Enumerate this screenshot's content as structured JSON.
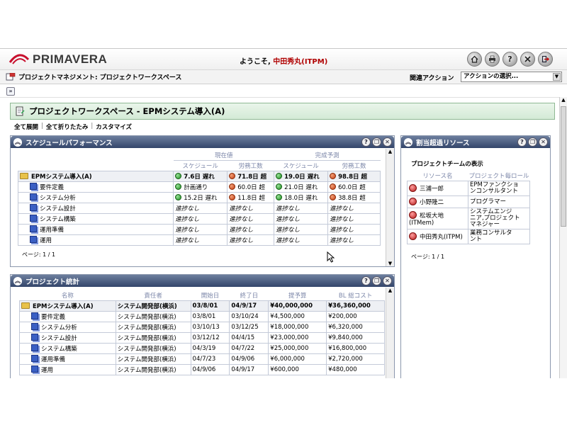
{
  "header": {
    "logo_text": "PRIMAVERA",
    "welcome_prefix": "ようこそ,",
    "user_name": "中田秀丸(ITPM)"
  },
  "breadcrumb": "プロジェクトマネジメント: プロジェクトワークスペース",
  "related_actions_label": "関連アクション",
  "action_select_value": "アクションの選択...",
  "workspace_title": "プロジェクトワークスペース - EPMシステム導入(A)",
  "links": {
    "expand_all": "全て展開",
    "collapse_all": "全て折りたたみ",
    "customize": "カスタマイズ"
  },
  "schedule": {
    "title": "スケジュールパフォーマンス",
    "group_current": "現在値",
    "group_forecast": "完成予測",
    "col_schedule": "スケジュール",
    "col_labor": "労務工数",
    "col_schedule2": "スケジュール",
    "col_labor2": "労務工数",
    "rows": [
      {
        "name": "EPMシステム導入(A)",
        "kind": "group",
        "s1": "7.6日 遅れ",
        "s1c": "g",
        "l1": "71.8日 超",
        "l1c": "r",
        "s2": "19.0日 遅れ",
        "s2c": "g",
        "l2": "98.8日 超",
        "l2c": "r"
      },
      {
        "name": "要件定義",
        "kind": "task",
        "s1": "計画通り",
        "s1c": "g",
        "l1": "60.0日 超",
        "l1c": "r",
        "s2": "21.0日 遅れ",
        "s2c": "g",
        "l2": "60.0日 超",
        "l2c": "r"
      },
      {
        "name": "システム分析",
        "kind": "task",
        "s1": "15.2日 遅れ",
        "s1c": "g",
        "l1": "11.8日 超",
        "l1c": "r",
        "s2": "18.0日 遅れ",
        "s2c": "g",
        "l2": "38.8日 超",
        "l2c": "r"
      },
      {
        "name": "システム設計",
        "kind": "task",
        "s1": "進捗なし",
        "l1": "進捗なし",
        "s2": "進捗なし",
        "l2": "進捗なし"
      },
      {
        "name": "システム構築",
        "kind": "task",
        "s1": "進捗なし",
        "l1": "進捗なし",
        "s2": "進捗なし",
        "l2": "進捗なし"
      },
      {
        "name": "運用準備",
        "kind": "task",
        "s1": "進捗なし",
        "l1": "進捗なし",
        "s2": "進捗なし",
        "l2": "進捗なし"
      },
      {
        "name": "運用",
        "kind": "task",
        "s1": "進捗なし",
        "l1": "進捗なし",
        "s2": "進捗なし",
        "l2": "進捗なし"
      }
    ],
    "page_info": "ページ: 1 / 1"
  },
  "resources": {
    "title": "割当超過リソース",
    "subtitle": "プロジェクトチームの表示",
    "col_resource": "リソース名",
    "col_role": "プロジェクト毎ロール",
    "rows": [
      {
        "name": "三浦一郎",
        "role": "EPMファンクショ\nンコンサルタント"
      },
      {
        "name": "小野隆二",
        "role": "プログラマー"
      },
      {
        "name": "松坂大地\n(ITMem)",
        "role": "システムエンジ\nニア,プロジェクト\nマネジャー"
      },
      {
        "name": "中田秀丸(ITPM)",
        "role": "業務コンサルタ\nント"
      }
    ],
    "page_info": "ページ: 1 / 1"
  },
  "stats": {
    "title": "プロジェクト統計",
    "cols": [
      "名称",
      "責任者",
      "開始日",
      "終了日",
      "提予算",
      "BL 総コスト"
    ],
    "rows": [
      {
        "name": "EPMシステム導入(A)",
        "kind": "group",
        "owner": "システム開発部(横浜)",
        "start": "03/8/01",
        "end": "04/9/17",
        "budget": "¥40,000,000",
        "cost": "¥36,360,000"
      },
      {
        "name": "要件定義",
        "kind": "task",
        "owner": "システム開発部(横浜)",
        "start": "03/8/01",
        "end": "03/10/24",
        "budget": "¥4,500,000",
        "cost": "¥200,000"
      },
      {
        "name": "システム分析",
        "kind": "task",
        "owner": "システム開発部(横浜)",
        "start": "03/10/13",
        "end": "03/12/25",
        "budget": "¥18,000,000",
        "cost": "¥6,320,000"
      },
      {
        "name": "システム設計",
        "kind": "task",
        "owner": "システム開発部(横浜)",
        "start": "03/12/12",
        "end": "04/4/15",
        "budget": "¥23,000,000",
        "cost": "¥9,840,000"
      },
      {
        "name": "システム構築",
        "kind": "task",
        "owner": "システム開発部(横浜)",
        "start": "04/3/19",
        "end": "04/7/22",
        "budget": "¥25,000,000",
        "cost": "¥16,800,000"
      },
      {
        "name": "運用準備",
        "kind": "task",
        "owner": "システム開発部(横浜)",
        "start": "04/7/23",
        "end": "04/9/06",
        "budget": "¥6,000,000",
        "cost": "¥2,720,000"
      },
      {
        "name": "運用",
        "kind": "task",
        "owner": "システム開発部(横浜)",
        "start": "04/9/06",
        "end": "04/9/17",
        "budget": "¥600,000",
        "cost": "¥480,000"
      }
    ]
  },
  "icons": {
    "header": [
      "home-icon",
      "print-icon",
      "help-icon",
      "tools-icon",
      "logout-icon"
    ],
    "portlet_buttons": [
      "help-icon",
      "restore-icon",
      "close-icon"
    ]
  }
}
